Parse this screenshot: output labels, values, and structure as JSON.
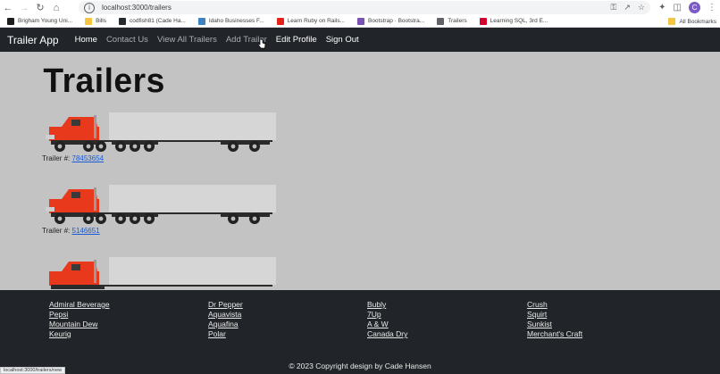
{
  "browser": {
    "url": "localhost:3000/trailers",
    "status_url": "localhost:3000/trailers/new",
    "avatar_letter": "C",
    "bookmarks": [
      {
        "label": "Brigham Young Uni...",
        "icon": "byu-icon",
        "color": "#1e1e1e"
      },
      {
        "label": "Bills",
        "icon": "folder-icon",
        "color": "#f5c542"
      },
      {
        "label": "codfish81 (Cade Ha...",
        "icon": "github-icon",
        "color": "#24292e"
      },
      {
        "label": "Idaho Businesses F...",
        "icon": "idaho-icon",
        "color": "#3b82c4"
      },
      {
        "label": "Learn Ruby on Rails...",
        "icon": "youtube-icon",
        "color": "#e62117"
      },
      {
        "label": "Bootstrap · Bootstra...",
        "icon": "bootstrap-icon",
        "color": "#7952b3"
      },
      {
        "label": "Trailers",
        "icon": "globe-icon",
        "color": "#5f6368"
      },
      {
        "label": "Learning SQL, 3rd E...",
        "icon": "oreilly-icon",
        "color": "#d3002d"
      }
    ],
    "all_bookmarks": "All Bookmarks"
  },
  "nav": {
    "brand": "Trailer App",
    "links": [
      "Home",
      "Contact Us",
      "View All Trailers",
      "Add Trailer",
      "Edit Profile",
      "Sign Out"
    ]
  },
  "page": {
    "title": "Trailers",
    "trailers": [
      {
        "label": "Trailer #:",
        "number": "78453654"
      },
      {
        "label": "Trailer #:",
        "number": "5146651"
      },
      {
        "label": "",
        "number": ""
      }
    ]
  },
  "footer": {
    "columns": [
      [
        "Admiral Beverage",
        "Pepsi",
        "Mountain Dew",
        "Keurig"
      ],
      [
        "Dr Pepper",
        "Aquavista",
        "Aquafina",
        "Polar"
      ],
      [
        "Bubly",
        "7Up",
        "A & W",
        "Canada Dry"
      ],
      [
        "Crush",
        "Squirt",
        "Sunkist",
        "Merchant's Craft"
      ]
    ],
    "copyright": "© 2023 Copyright design by Cade Hansen"
  },
  "colors": {
    "navbar": "#212529",
    "page_bg": "#c3c3c3",
    "truck_cab": "#e8391c",
    "link": "#1a5cd6"
  }
}
